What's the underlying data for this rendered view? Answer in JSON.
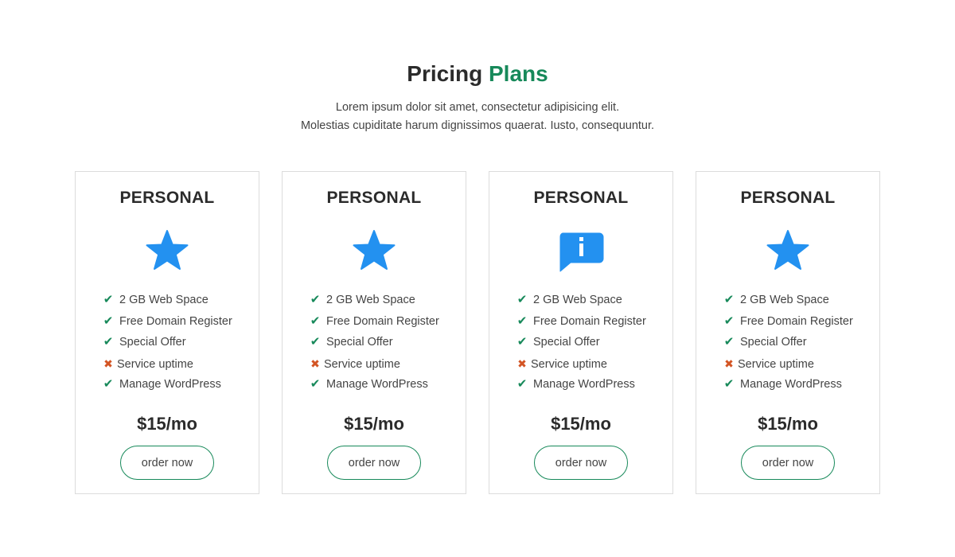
{
  "header": {
    "title_main": "Pricing",
    "title_accent": "Plans",
    "subtitle_line1": "Lorem ipsum dolor sit amet, consectetur adipisicing elit.",
    "subtitle_line2": "Molestias cupiditate harum dignissimos quaerat. Iusto, consequuntur."
  },
  "colors": {
    "accent": "#17895a",
    "icon_blue": "#2391f0",
    "check": "#17895a",
    "cross": "#d35423"
  },
  "plans": [
    {
      "name": "PERSONAL",
      "icon": "star-icon",
      "features": [
        {
          "label": "2 GB Web Space",
          "included": true
        },
        {
          "label": "Free Domain Register",
          "included": true
        },
        {
          "label": "Special Offer",
          "included": true
        },
        {
          "label": "Service uptime",
          "included": false
        },
        {
          "label": "Manage WordPress",
          "included": true
        }
      ],
      "price": "$15/mo",
      "button_label": "order now"
    },
    {
      "name": "PERSONAL",
      "icon": "star-icon",
      "features": [
        {
          "label": "2 GB Web Space",
          "included": true
        },
        {
          "label": "Free Domain Register",
          "included": true
        },
        {
          "label": "Special Offer",
          "included": true
        },
        {
          "label": "Service uptime",
          "included": false
        },
        {
          "label": "Manage WordPress",
          "included": true
        }
      ],
      "price": "$15/mo",
      "button_label": "order now"
    },
    {
      "name": "PERSONAL",
      "icon": "info-speech-bubble-icon",
      "features": [
        {
          "label": "2 GB Web Space",
          "included": true
        },
        {
          "label": "Free Domain Register",
          "included": true
        },
        {
          "label": "Special Offer",
          "included": true
        },
        {
          "label": "Service uptime",
          "included": false
        },
        {
          "label": "Manage WordPress",
          "included": true
        }
      ],
      "price": "$15/mo",
      "button_label": "order now"
    },
    {
      "name": "PERSONAL",
      "icon": "star-icon",
      "features": [
        {
          "label": "2 GB Web Space",
          "included": true
        },
        {
          "label": "Free Domain Register",
          "included": true
        },
        {
          "label": "Special Offer",
          "included": true
        },
        {
          "label": "Service uptime",
          "included": false
        },
        {
          "label": "Manage WordPress",
          "included": true
        }
      ],
      "price": "$15/mo",
      "button_label": "order now"
    }
  ]
}
